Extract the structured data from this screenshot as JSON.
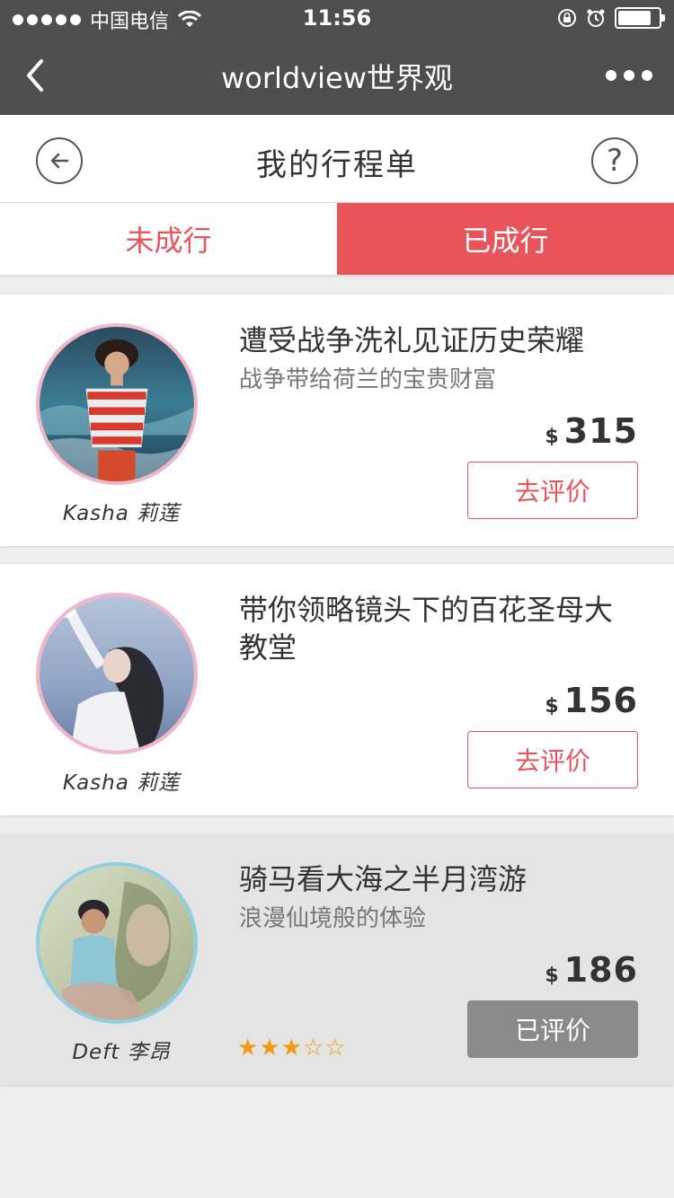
{
  "status_bar": {
    "carrier": "中国电信",
    "time": "11:56"
  },
  "nav": {
    "title": "worldview世界观"
  },
  "page": {
    "title": "我的行程单"
  },
  "tabs": [
    {
      "label": "未成行",
      "active": false
    },
    {
      "label": "已成行",
      "active": true
    }
  ],
  "trips": [
    {
      "title": "遭受战争洗礼见证历史荣耀",
      "subtitle": "战争带给荷兰的宝贵财富",
      "currency": "$",
      "price": "315",
      "guide": "Kasha 莉莲",
      "action": "去评价"
    },
    {
      "title": "带你领略镜头下的百花圣母大教堂",
      "subtitle": "",
      "currency": "$",
      "price": "156",
      "guide": "Kasha 莉莲",
      "action": "去评价"
    },
    {
      "title": "骑马看大海之半月湾游",
      "subtitle": "浪漫仙境般的体验",
      "currency": "$",
      "price": "186",
      "guide": "Deft 李昂",
      "action": "已评价",
      "rating": 3,
      "rating_max": 5,
      "stars_text": "★★★☆☆"
    }
  ],
  "colors": {
    "accent": "#e9545a",
    "navbar": "#4e4e4e",
    "star": "#f29a12"
  }
}
